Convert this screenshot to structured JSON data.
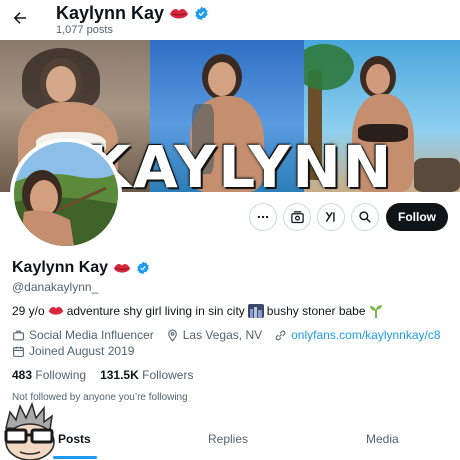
{
  "header": {
    "name": "Kaylynn Kay",
    "posts": "1,077 posts",
    "back_icon": "arrow-left-icon"
  },
  "banner": {
    "word": "KAYLYNN"
  },
  "actions": {
    "more_icon": "more-icon",
    "subscribe_icon": "subscribe-icon",
    "grok_icon": "grok-icon",
    "search_icon": "search-icon",
    "follow_label": "Follow"
  },
  "profile": {
    "name": "Kaylynn Kay",
    "handle": "@danakaylynn_",
    "bio_part1": "29 y/o",
    "bio_part2": "adventure shy girl living in sin city",
    "bio_part3": "bushy stoner babe",
    "category": "Social Media Influencer",
    "location": "Las Vegas, NV",
    "link": "onlyfans.com/kaylynnkay/c8",
    "joined": "Joined August 2019",
    "following_count": "483",
    "following_label": "Following",
    "followers_count": "131.5K",
    "followers_label": "Followers",
    "not_followed": "Not followed by anyone you’re following"
  },
  "tabs": [
    {
      "label": "Posts",
      "active": true
    },
    {
      "label": "Replies",
      "active": false
    },
    {
      "label": "Media",
      "active": false
    }
  ],
  "colors": {
    "accent": "#1d9bf0",
    "text": "#0f1419",
    "muted": "#536471",
    "follow_bg": "#0f1419"
  }
}
